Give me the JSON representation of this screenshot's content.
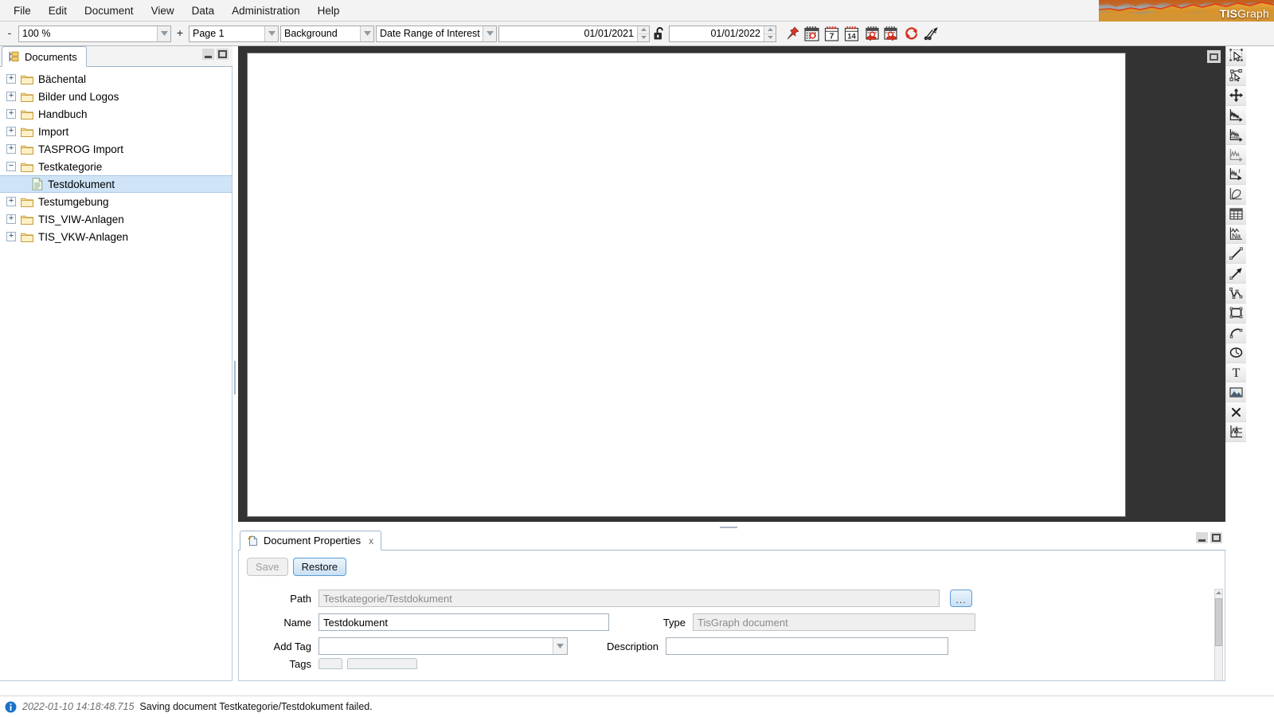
{
  "app": {
    "brand_tis": "TIS",
    "brand_graph": "Graph",
    "accent": "#5b9bd5",
    "canvas_bg": "#333333"
  },
  "menubar": {
    "items": [
      {
        "label": "File",
        "name": "menu-file"
      },
      {
        "label": "Edit",
        "name": "menu-edit"
      },
      {
        "label": "Document",
        "name": "menu-document"
      },
      {
        "label": "View",
        "name": "menu-view"
      },
      {
        "label": "Data",
        "name": "menu-data"
      },
      {
        "label": "Administration",
        "name": "menu-administration"
      },
      {
        "label": "Help",
        "name": "menu-help"
      }
    ]
  },
  "toolbar": {
    "zoom_out_label": "-",
    "zoom_value": "100 %",
    "zoom_in_label": "+",
    "page_value": "Page 1",
    "layer_value": "Background",
    "daterange_value": "Date Range of Interest",
    "date_from": "01/01/2021",
    "date_to": "01/01/2022",
    "icons": [
      {
        "name": "pin-icon",
        "title": "Pin date range"
      },
      {
        "name": "calendar-today-icon",
        "title": "Today"
      },
      {
        "name": "calendar-7-icon",
        "title": "Last 7 days"
      },
      {
        "name": "calendar-14-icon",
        "title": "Last 14 days"
      },
      {
        "name": "calendar-shift-back-icon",
        "title": "Shift back"
      },
      {
        "name": "calendar-shift-forward-icon",
        "title": "Shift forward"
      },
      {
        "name": "refresh-icon",
        "title": "Refresh"
      },
      {
        "name": "scatter-tool-icon",
        "title": "Scatter tool"
      }
    ],
    "lock_icon": "unlocked-padlock-icon"
  },
  "tree_panel": {
    "tab_label": "Documents",
    "tab_icon": "documents-tree-icon",
    "minimize_label": "minimize",
    "maximize_label": "maximize",
    "nodes": [
      {
        "label": "Bächental",
        "expander": "+",
        "icon": "folder-icon",
        "level": 0,
        "selected": false
      },
      {
        "label": "Bilder und Logos",
        "expander": "+",
        "icon": "folder-icon",
        "level": 0,
        "selected": false
      },
      {
        "label": "Handbuch",
        "expander": "+",
        "icon": "folder-icon",
        "level": 0,
        "selected": false
      },
      {
        "label": "Import",
        "expander": "+",
        "icon": "folder-icon",
        "level": 0,
        "selected": false
      },
      {
        "label": "TASPROG Import",
        "expander": "+",
        "icon": "folder-icon",
        "level": 0,
        "selected": false
      },
      {
        "label": "Testkategorie",
        "expander": "−",
        "icon": "folder-icon",
        "level": 0,
        "selected": false
      },
      {
        "label": "Testdokument",
        "expander": "",
        "icon": "document-icon",
        "level": 1,
        "selected": true
      },
      {
        "label": "Testumgebung",
        "expander": "+",
        "icon": "folder-icon",
        "level": 0,
        "selected": false
      },
      {
        "label": "TIS_VIW-Anlagen",
        "expander": "+",
        "icon": "folder-icon",
        "level": 0,
        "selected": false
      },
      {
        "label": "TIS_VKW-Anlagen",
        "expander": "+",
        "icon": "folder-icon",
        "level": 0,
        "selected": false
      }
    ]
  },
  "vtoolbar": {
    "items": [
      {
        "name": "select-arrow-icon",
        "title": "Select"
      },
      {
        "name": "node-edit-icon",
        "title": "Edit nodes"
      },
      {
        "name": "move-icon",
        "title": "Move"
      },
      {
        "name": "timeseries-chart-icon",
        "title": "Time series chart"
      },
      {
        "name": "multi-trace-chart-icon",
        "title": "Multi trace chart"
      },
      {
        "name": "signal-chart-icon",
        "title": "Signal chart"
      },
      {
        "name": "time-function-chart-icon",
        "title": "Time function chart"
      },
      {
        "name": "xy-scatter-icon",
        "title": "XY plot"
      },
      {
        "name": "table-icon",
        "title": "Table"
      },
      {
        "name": "na-curve-icon",
        "title": "Na curve"
      },
      {
        "name": "line-icon",
        "title": "Line"
      },
      {
        "name": "arrow-icon",
        "title": "Arrow"
      },
      {
        "name": "polyline-icon",
        "title": "Polyline"
      },
      {
        "name": "rectangle-icon",
        "title": "Rectangle"
      },
      {
        "name": "arc-icon",
        "title": "Arc"
      },
      {
        "name": "ellipse-icon",
        "title": "Ellipse"
      },
      {
        "name": "text-icon",
        "title": "Text"
      },
      {
        "name": "image-icon",
        "title": "Image"
      },
      {
        "name": "delete-icon",
        "title": "Delete"
      },
      {
        "name": "axis-tool-icon",
        "title": "Axis tool"
      }
    ]
  },
  "canvas": {
    "minimize_label": "minimize"
  },
  "properties": {
    "tab_label": "Document Properties",
    "tab_icon": "document-properties-icon",
    "close_label": "x",
    "save_label": "Save",
    "restore_label": "Restore",
    "browse_label": "...",
    "fields": {
      "path_label": "Path",
      "path_value": "Testkategorie/Testdokument",
      "name_label": "Name",
      "name_value": "Testdokument",
      "type_label": "Type",
      "type_value": "TisGraph document",
      "addtag_label": "Add Tag",
      "addtag_value": "",
      "description_label": "Description",
      "description_value": "",
      "tags_label": "Tags"
    }
  },
  "statusbar": {
    "icon": "info-icon",
    "timestamp": "2022-01-10 14:18:48.715",
    "message": "Saving document Testkategorie/Testdokument failed."
  }
}
